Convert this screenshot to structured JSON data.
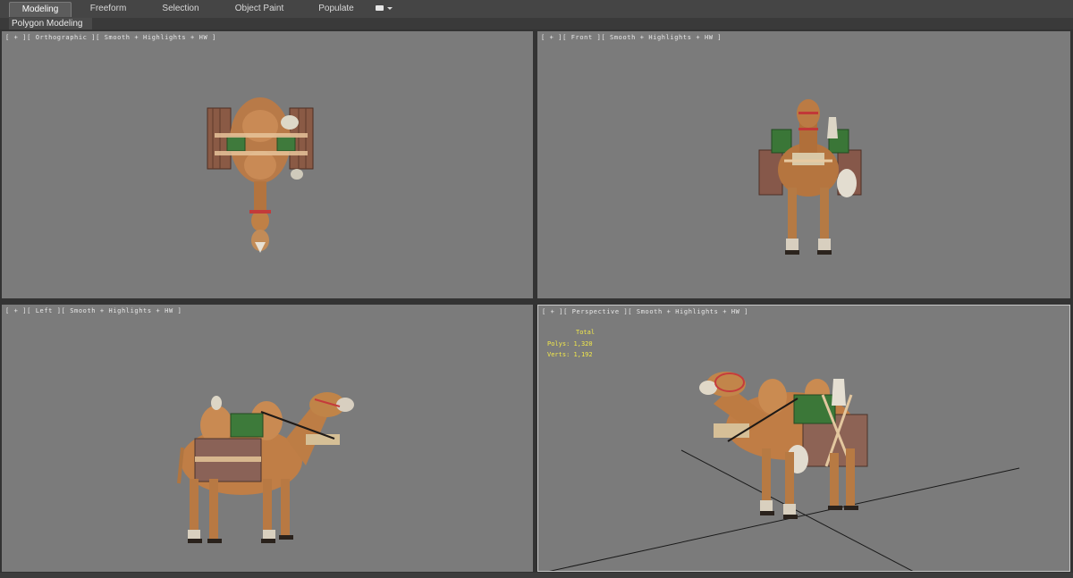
{
  "ribbon": {
    "tabs": [
      {
        "label": "Modeling",
        "active": true
      },
      {
        "label": "Freeform"
      },
      {
        "label": "Selection"
      },
      {
        "label": "Object Paint"
      },
      {
        "label": "Populate"
      }
    ]
  },
  "subpanel": {
    "label": "Polygon Modeling"
  },
  "viewports": {
    "top_left": {
      "label": "[ + ][ Orthographic ][ Smooth + Highlights + HW ]"
    },
    "top_right": {
      "label": "[ + ][ Front ][ Smooth + Highlights + HW ]"
    },
    "bottom_left": {
      "label": "[ + ][ Left ][ Smooth + Highlights + HW ]"
    },
    "bottom_right": {
      "label": "[ + ][ Perspective ][ Smooth + Highlights + HW ]",
      "stats": {
        "title": "Total",
        "polys_label": "Polys:",
        "polys": "1,320",
        "verts_label": "Verts:",
        "verts": "1,192"
      }
    }
  },
  "colors": {
    "viewport_bg": "#7b7b7b",
    "stats_text": "#f2e84a",
    "active_viewport_border": "#c8c8c8"
  }
}
